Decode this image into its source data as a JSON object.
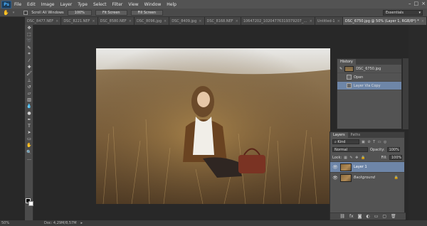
{
  "app": {
    "logo": "Ps"
  },
  "menu": [
    "File",
    "Edit",
    "Image",
    "Layer",
    "Type",
    "Select",
    "Filter",
    "View",
    "Window",
    "Help"
  ],
  "window_controls": [
    "–",
    "□",
    "×"
  ],
  "options_bar": {
    "scroll_all_windows": "Scroll All Windows",
    "buttons": [
      "100%",
      "Fit Screen",
      "Fill Screen"
    ],
    "workspace": "Essentials"
  },
  "tabs": [
    {
      "label": "DSC_8477.NEF",
      "active": false
    },
    {
      "label": "DSC_8221.NEF",
      "active": false
    },
    {
      "label": "DSC_8580.NEF",
      "active": false
    },
    {
      "label": "DSC_8096.jpg",
      "active": false
    },
    {
      "label": "DSC_8409.jpg",
      "active": false
    },
    {
      "label": "DSC_8168.NEF",
      "active": false
    },
    {
      "label": "10647202_10204776319379207_2909540115386103710_o.jpg",
      "active": false
    },
    {
      "label": "Untitled-1",
      "active": false
    },
    {
      "label": "DSC_6750.jpg @ 50% (Layer 1, RGB/8*) *",
      "active": true
    }
  ],
  "history": {
    "tabs": [
      "History"
    ],
    "snapshot": "DSC_6750.jpg",
    "items": [
      {
        "label": "Open",
        "selected": false
      },
      {
        "label": "Layer Via Copy",
        "selected": true
      }
    ]
  },
  "layers": {
    "tabs": [
      "Layers",
      "Paths"
    ],
    "filter": "Kind",
    "blend_mode": "Normal",
    "opacity_label": "Opacity:",
    "opacity": "100%",
    "lock_label": "Lock:",
    "fill_label": "Fill:",
    "fill": "100%",
    "items": [
      {
        "name": "Layer 1",
        "selected": true
      },
      {
        "name": "Background",
        "selected": false
      }
    ]
  },
  "status": {
    "zoom": "50%",
    "doc": "Doc: 4,29M/8,57M"
  }
}
